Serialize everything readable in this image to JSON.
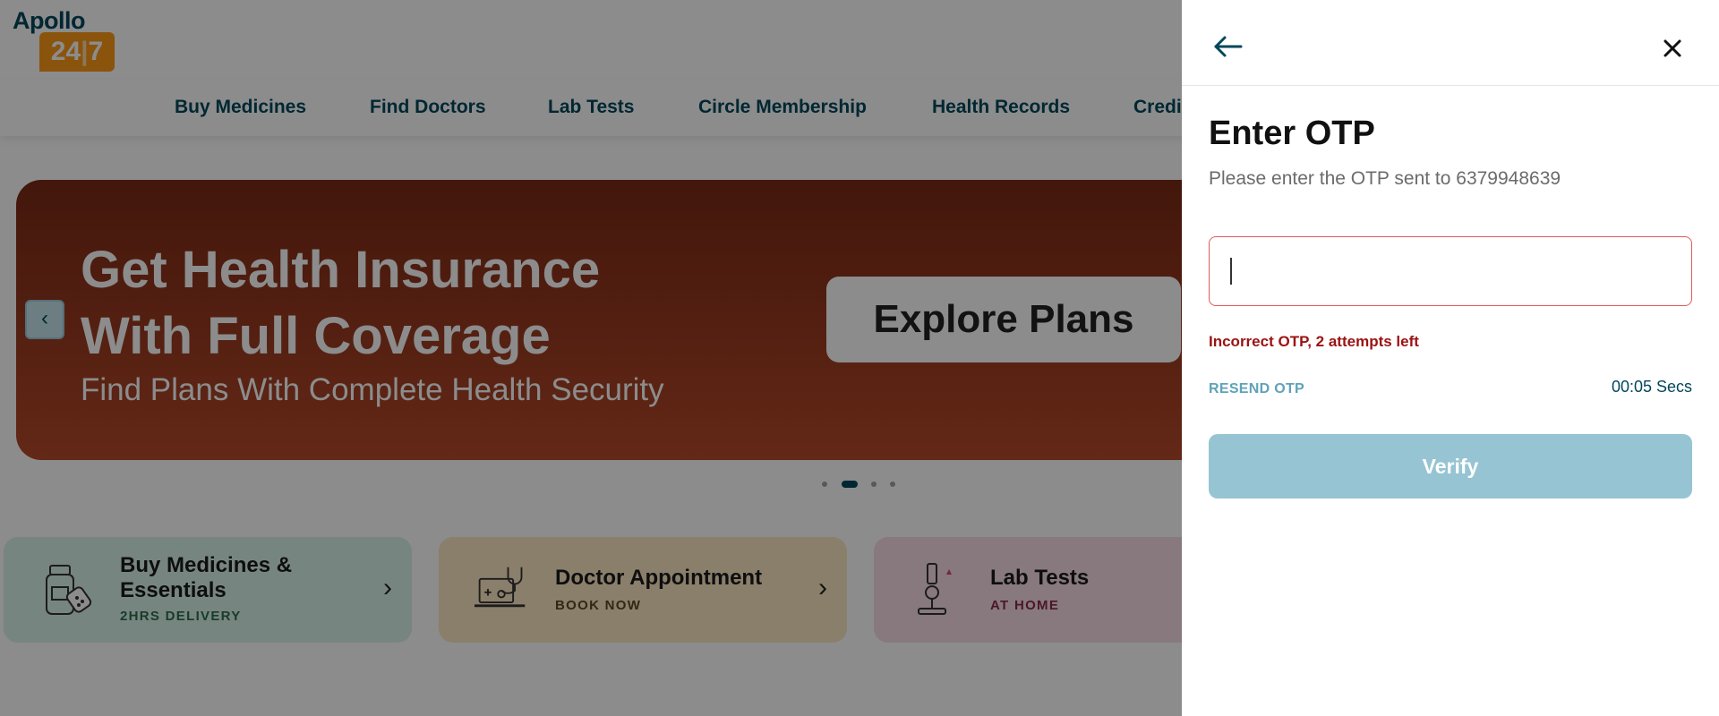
{
  "logo": {
    "brand": "Apollo",
    "digits_left": "24",
    "digits_right": "7"
  },
  "nav": {
    "items": [
      {
        "label": "Buy Medicines"
      },
      {
        "label": "Find Doctors"
      },
      {
        "label": "Lab Tests"
      },
      {
        "label": "Circle Membership"
      },
      {
        "label": "Health Records"
      },
      {
        "label": "Credi"
      }
    ]
  },
  "banner": {
    "title_line1": "Get Health Insurance",
    "title_line2": "With Full Coverage",
    "subtitle": "Find Plans With Complete Health Security",
    "button_label": "Explore Plans",
    "prev_icon": "chevron-left-icon",
    "slide_count": 4,
    "active_slide": 2,
    "gradient": [
      "#7a2a16",
      "#b5492a"
    ]
  },
  "service_cards": [
    {
      "title_line1": "Buy Medicines &",
      "title_line2": "Essentials",
      "subtitle": "2HRS DELIVERY",
      "icon": "medicine-bottle-icon",
      "bg": "#d9f2ea",
      "subtitle_color": "#2c6e4f"
    },
    {
      "title_line1": "Doctor Appointment",
      "title_line2": "",
      "subtitle": "BOOK NOW",
      "icon": "doctor-laptop-icon",
      "bg": "#fbe7c3",
      "subtitle_color": "#5a4a1f"
    },
    {
      "title_line1": "Lab Tests",
      "title_line2": "",
      "subtitle": "AT HOME",
      "icon": "microscope-icon",
      "bg": "#f6dde6",
      "subtitle_color": "#8a2a4a"
    }
  ],
  "otp": {
    "title": "Enter OTP",
    "description": "Please enter the OTP sent to 6379948639",
    "input_value": "",
    "error": "Incorrect OTP, 2 attempts left",
    "resend_label": "RESEND OTP",
    "timer": "00:05 Secs",
    "verify_label": "Verify",
    "back_icon": "arrow-left-icon",
    "close_icon": "close-icon"
  },
  "colors": {
    "brand_dark": "#02475b",
    "brand_orange": "#fc9916",
    "error": "#9b1212",
    "input_border_error": "#e05a5a",
    "verify_disabled": "#96c4d2",
    "resend": "#5fa3b7"
  }
}
